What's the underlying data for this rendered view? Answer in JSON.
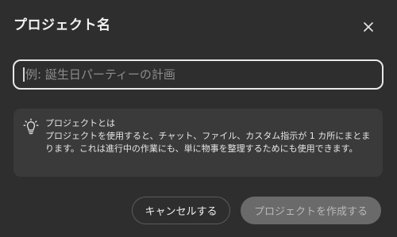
{
  "dialog": {
    "title": "プロジェクト名",
    "close_icon": "close-icon"
  },
  "name_input": {
    "value": "",
    "placeholder": "例: 誕生日パーティーの計画"
  },
  "info": {
    "icon": "lightbulb-icon",
    "heading": "プロジェクトとは",
    "body": "プロジェクトを使用すると、チャット、ファイル、カスタム指示が 1 カ所にまとまります。これは進行中の作業にも、単に物事を整理するためにも使用できます。"
  },
  "buttons": {
    "cancel_label": "キャンセルする",
    "create_label": "プロジェクトを作成する",
    "create_disabled": true
  },
  "colors": {
    "background": "#2e2e2e",
    "info_box": "#3a3a3a",
    "input_border": "#e8e8e8",
    "create_button_disabled": "#6a6a6a"
  }
}
